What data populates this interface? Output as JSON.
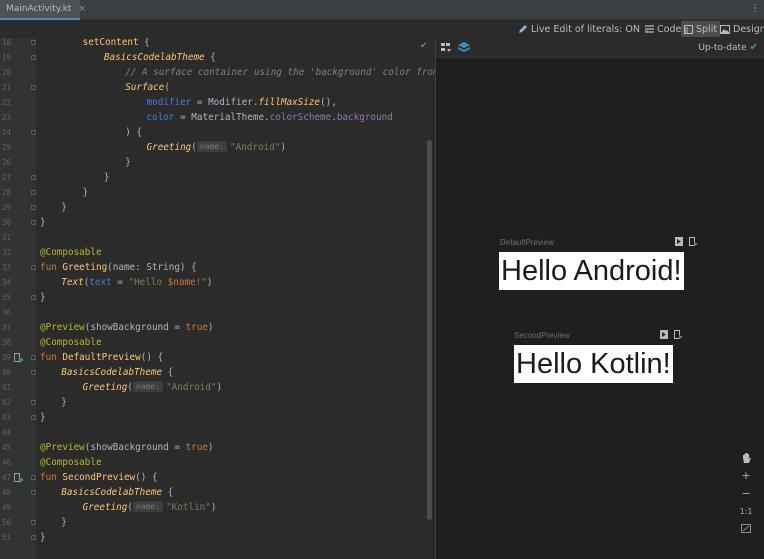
{
  "tab": {
    "filename": "MainActivity.kt",
    "close": "×",
    "more": "⋮"
  },
  "toolbar": {
    "live_edit": "Live Edit of literals: ON",
    "code": "Code",
    "split": "Split",
    "design": "Design"
  },
  "editor": {
    "line_numbers": [
      "18",
      "19",
      "20",
      "21",
      "22",
      "23",
      "24",
      "25",
      "26",
      "27",
      "28",
      "29",
      "30",
      "31",
      "32",
      "33",
      "34",
      "35",
      "36",
      "37",
      "38",
      "39",
      "40",
      "41",
      "42",
      "43",
      "44",
      "45",
      "46",
      "47",
      "48",
      "49",
      "50",
      "51"
    ],
    "lines": [
      {
        "indent": 2,
        "tokens": [
          {
            "t": "setContent",
            "c": "fn"
          },
          {
            "t": " {"
          }
        ]
      },
      {
        "indent": 3,
        "tokens": [
          {
            "t": "BasicsCodelabTheme",
            "c": "fn it"
          },
          {
            "t": " {"
          }
        ]
      },
      {
        "indent": 4,
        "tokens": [
          {
            "t": "// A surface container using the 'background' color from th",
            "c": "comment"
          }
        ]
      },
      {
        "indent": 4,
        "tokens": [
          {
            "t": "Surface",
            "c": "fn it"
          },
          {
            "t": "("
          }
        ]
      },
      {
        "indent": 5,
        "tokens": [
          {
            "t": "modifier",
            "c": "param"
          },
          {
            "t": " = Modifier."
          },
          {
            "t": "fillMaxSize",
            "c": "fn it"
          },
          {
            "t": "(),"
          }
        ]
      },
      {
        "indent": 5,
        "tokens": [
          {
            "t": "color",
            "c": "param"
          },
          {
            "t": " = MaterialTheme."
          },
          {
            "t": "colorScheme",
            "c": "prop"
          },
          {
            "t": "."
          },
          {
            "t": "background",
            "c": "prop"
          }
        ]
      },
      {
        "indent": 4,
        "tokens": [
          {
            "t": ") {"
          }
        ]
      },
      {
        "indent": 5,
        "tokens": [
          {
            "t": "Greeting",
            "c": "fn it"
          },
          {
            "t": "("
          },
          {
            "hint": "name:"
          },
          {
            "t": "\"Android\"",
            "c": "str"
          },
          {
            "t": ")"
          }
        ]
      },
      {
        "indent": 4,
        "tokens": [
          {
            "t": "}"
          }
        ]
      },
      {
        "indent": 3,
        "tokens": [
          {
            "t": "}"
          }
        ]
      },
      {
        "indent": 2,
        "tokens": [
          {
            "t": "}"
          }
        ]
      },
      {
        "indent": 1,
        "tokens": [
          {
            "t": "}"
          }
        ]
      },
      {
        "indent": 0,
        "tokens": [
          {
            "t": "}"
          }
        ]
      },
      {
        "indent": 0,
        "tokens": []
      },
      {
        "indent": 0,
        "tokens": [
          {
            "t": "@Composable",
            "c": "ann"
          }
        ]
      },
      {
        "indent": 0,
        "tokens": [
          {
            "t": "fun ",
            "c": "kw"
          },
          {
            "t": "Greeting",
            "c": "fn"
          },
          {
            "t": "(name: String) {"
          }
        ]
      },
      {
        "indent": 1,
        "tokens": [
          {
            "t": "Text",
            "c": "fn it"
          },
          {
            "t": "("
          },
          {
            "t": "text",
            "c": "param"
          },
          {
            "t": " = "
          },
          {
            "t": "\"Hello ",
            "c": "str"
          },
          {
            "t": "$name",
            "c": "kw"
          },
          {
            "t": "!\"",
            "c": "str"
          },
          {
            "t": ")"
          }
        ]
      },
      {
        "indent": 0,
        "tokens": [
          {
            "t": "}"
          }
        ]
      },
      {
        "indent": 0,
        "tokens": []
      },
      {
        "indent": 0,
        "tokens": [
          {
            "t": "@Preview",
            "c": "ann"
          },
          {
            "t": "(showBackground = "
          },
          {
            "t": "true",
            "c": "kw"
          },
          {
            "t": ")"
          }
        ]
      },
      {
        "indent": 0,
        "tokens": [
          {
            "t": "@Composable",
            "c": "ann"
          }
        ]
      },
      {
        "indent": 0,
        "tokens": [
          {
            "t": "fun ",
            "c": "kw"
          },
          {
            "t": "DefaultPreview",
            "c": "fn"
          },
          {
            "t": "() {"
          }
        ]
      },
      {
        "indent": 1,
        "tokens": [
          {
            "t": "BasicsCodelabTheme",
            "c": "fn it"
          },
          {
            "t": " {"
          }
        ]
      },
      {
        "indent": 2,
        "tokens": [
          {
            "t": "Greeting",
            "c": "fn it"
          },
          {
            "t": "("
          },
          {
            "hint": "name:"
          },
          {
            "t": "\"Android\"",
            "c": "str"
          },
          {
            "t": ")"
          }
        ]
      },
      {
        "indent": 1,
        "tokens": [
          {
            "t": "}"
          }
        ]
      },
      {
        "indent": 0,
        "tokens": [
          {
            "t": "}"
          }
        ]
      },
      {
        "indent": 0,
        "tokens": []
      },
      {
        "indent": 0,
        "tokens": [
          {
            "t": "@Preview",
            "c": "ann"
          },
          {
            "t": "(showBackground = "
          },
          {
            "t": "true",
            "c": "kw"
          },
          {
            "t": ")"
          }
        ]
      },
      {
        "indent": 0,
        "tokens": [
          {
            "t": "@Composable",
            "c": "ann"
          }
        ]
      },
      {
        "indent": 0,
        "tokens": [
          {
            "t": "fun ",
            "c": "kw"
          },
          {
            "t": "SecondPreview",
            "c": "fn"
          },
          {
            "t": "() {"
          }
        ]
      },
      {
        "indent": 1,
        "tokens": [
          {
            "t": "BasicsCodelabTheme",
            "c": "fn it"
          },
          {
            "t": " {"
          }
        ]
      },
      {
        "indent": 2,
        "tokens": [
          {
            "t": "Greeting",
            "c": "fn it"
          },
          {
            "t": "("
          },
          {
            "hint": "name:"
          },
          {
            "t": "\"Kotlin\"",
            "c": "str"
          },
          {
            "t": ")"
          }
        ]
      },
      {
        "indent": 1,
        "tokens": [
          {
            "t": "}"
          }
        ]
      },
      {
        "indent": 0,
        "tokens": [
          {
            "t": "}"
          }
        ]
      }
    ],
    "fold_lines": [
      0,
      1,
      3,
      6,
      9,
      10,
      11,
      12,
      15,
      17,
      21,
      22,
      24,
      25,
      29,
      30,
      32,
      33
    ],
    "run_lines": [
      21,
      29
    ]
  },
  "preview": {
    "status": "Up-to-date",
    "status_icon": "✔",
    "cards": [
      {
        "label": "DefaultPreview",
        "text": "Hello Android!"
      },
      {
        "label": "SecondPreview",
        "text": "Hello Kotlin!"
      }
    ],
    "zoom": {
      "plus": "+",
      "minus": "−",
      "one_to_one": "1:1"
    }
  },
  "colors": {
    "keyword": "#cc7832",
    "annotation": "#bbb529",
    "function": "#ffc66d",
    "string": "#6a8759",
    "named_param": "#467cda",
    "property": "#9876aa",
    "ok_green": "#499c54"
  }
}
